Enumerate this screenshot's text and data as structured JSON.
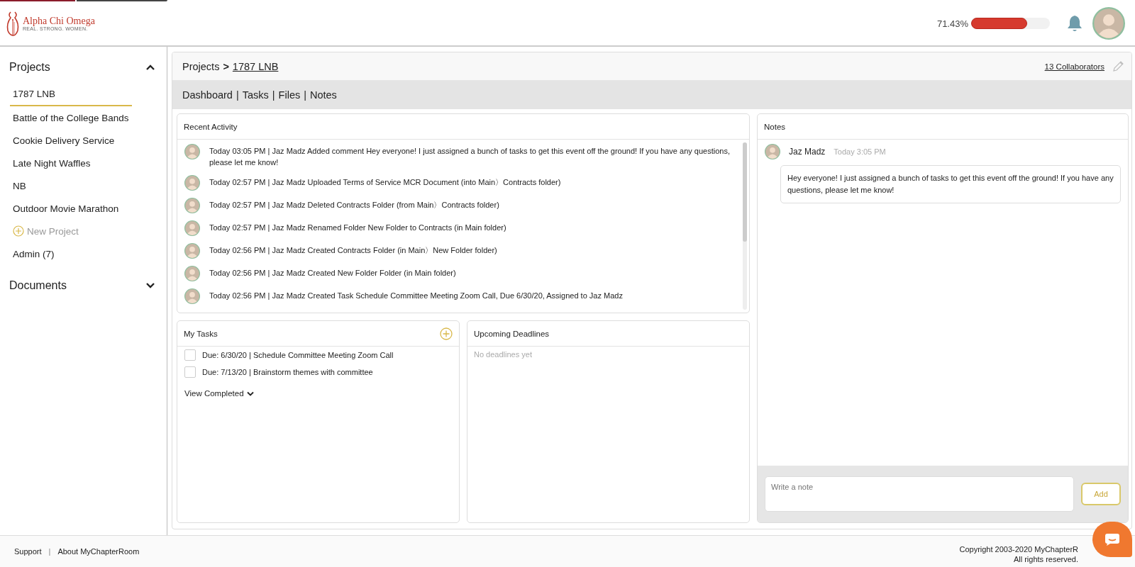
{
  "header": {
    "logo": {
      "name": "Alpha Chi Omega",
      "tagline": "REAL. STRONG. WOMEN."
    },
    "progress": {
      "reading": "71.43%",
      "level": 0.7143
    }
  },
  "sidebar": {
    "sections": [
      {
        "title": "Projects",
        "expanded": true,
        "items": [
          {
            "label": "1787 LNB",
            "selected": true,
            "kind": "project"
          },
          {
            "label": "Battle of the College Bands",
            "selected": false,
            "kind": "project"
          },
          {
            "label": "Cookie Delivery Service",
            "selected": false,
            "kind": "project"
          },
          {
            "label": "Late Night Waffles",
            "selected": false,
            "kind": "project"
          },
          {
            "label": "NB",
            "selected": false,
            "kind": "project"
          },
          {
            "label": "Outdoor Movie Marathon",
            "selected": false,
            "kind": "project"
          },
          {
            "label": "New Project",
            "selected": false,
            "kind": "add"
          },
          {
            "label": "Admin (7)",
            "selected": false,
            "kind": "project"
          }
        ]
      },
      {
        "title": "Documents",
        "expanded": false
      }
    ]
  },
  "breadcrumb": {
    "root": "Projects",
    "separator": ">",
    "current": "1787 LNB",
    "collaborators": "13 Collaborators"
  },
  "tabs": [
    "Dashboard",
    "Tasks",
    "Files",
    "Notes"
  ],
  "tab_separator": "|",
  "recent_activity": {
    "title": "Recent Activity",
    "items": [
      "Today 03:05 PM | Jaz Madz Added comment Hey everyone! I just assigned a bunch of tasks to get this event off the ground! If you have any questions, please let me know!",
      "Today 02:57 PM | Jaz Madz Uploaded Terms of Service MCR Document (into Main〉Contracts folder)",
      "Today 02:57 PM | Jaz Madz Deleted Contracts Folder (from Main〉Contracts folder)",
      "Today 02:57 PM | Jaz Madz Renamed Folder New Folder to Contracts (in Main folder)",
      "Today 02:56 PM | Jaz Madz Created Contracts Folder (in Main〉New Folder folder)",
      "Today 02:56 PM | Jaz Madz Created New Folder Folder (in Main folder)",
      "Today 02:56 PM | Jaz Madz Created Task Schedule Committee Meeting Zoom Call, Due 6/30/20, Assigned to Jaz Madz"
    ]
  },
  "my_tasks": {
    "title": "My Tasks",
    "items": [
      {
        "text": "Due: 6/30/20 | Schedule Committee Meeting Zoom Call",
        "checked": false
      },
      {
        "text": "Due: 7/13/20 | Brainstorm themes with committee",
        "checked": false
      }
    ],
    "view_completed": "View Completed"
  },
  "upcoming_deadlines": {
    "title": "Upcoming Deadlines",
    "empty": "No deadlines yet"
  },
  "notes": {
    "title": "Notes",
    "items": [
      {
        "author": "Jaz Madz",
        "time": "Today 3:05 PM",
        "text": "Hey everyone! I just assigned a bunch of tasks to get this event off the ground! If you have any questions, please let me know!"
      }
    ],
    "placeholder": "Write a note",
    "add_button": "Add"
  },
  "footer": {
    "links": [
      "Support",
      "About MyChapterRoom"
    ],
    "separator": "|",
    "copyright": "Copyright 2003-2020 MyChapterR",
    "rights": "All rights reserved."
  }
}
